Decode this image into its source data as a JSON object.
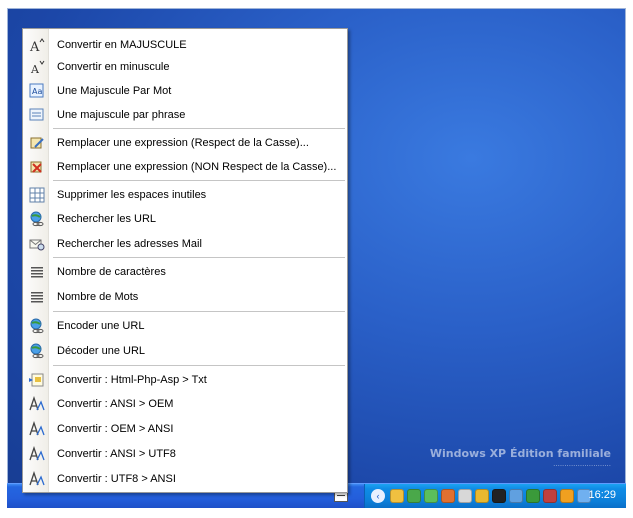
{
  "menu": {
    "items": [
      {
        "label": "Convertir en MAJUSCULE",
        "icon": "uppercase-a-icon"
      },
      {
        "label": "Convertir en minuscule",
        "icon": "lowercase-a-icon"
      },
      {
        "label": "Une Majuscule Par Mot",
        "icon": "capitalize-word-icon"
      },
      {
        "label": "Une majuscule par phrase",
        "icon": "capitalize-sentence-icon"
      },
      {
        "label": "Remplacer une expression (Respect de la Casse)...",
        "icon": "replace-case-icon"
      },
      {
        "label": "Remplacer une expression (NON Respect de la Casse)...",
        "icon": "replace-nocase-icon"
      },
      {
        "label": "Supprimer les espaces inutiles",
        "icon": "remove-spaces-icon"
      },
      {
        "label": "Rechercher les URL",
        "icon": "globe-link-icon"
      },
      {
        "label": "Rechercher les adresses Mail",
        "icon": "mail-search-icon"
      },
      {
        "label": "Nombre de caractères",
        "icon": "lines-icon"
      },
      {
        "label": "Nombre de Mots",
        "icon": "lines-icon"
      },
      {
        "label": "Encoder une URL",
        "icon": "globe-link-icon"
      },
      {
        "label": "Décoder une URL",
        "icon": "globe-link-icon"
      },
      {
        "label": "Convertir : Html-Php-Asp > Txt",
        "icon": "html-convert-icon"
      },
      {
        "label": "Convertir : ANSI > OEM",
        "icon": "charset-convert-icon"
      },
      {
        "label": "Convertir : OEM > ANSI",
        "icon": "charset-convert-icon"
      },
      {
        "label": "Convertir : ANSI > UTF8",
        "icon": "charset-convert-icon"
      },
      {
        "label": "Convertir : UTF8 > ANSI",
        "icon": "charset-convert-icon"
      }
    ]
  },
  "desktop": {
    "watermark_title": "Windows XP Édition familiale"
  },
  "taskbar": {
    "clock": "16:29"
  },
  "colors": {
    "desktop_blue": "#2a60c8",
    "taskbar_blue": "#245edb",
    "tray_blue": "#0f8ce6",
    "separator": "#c5c5c5"
  }
}
